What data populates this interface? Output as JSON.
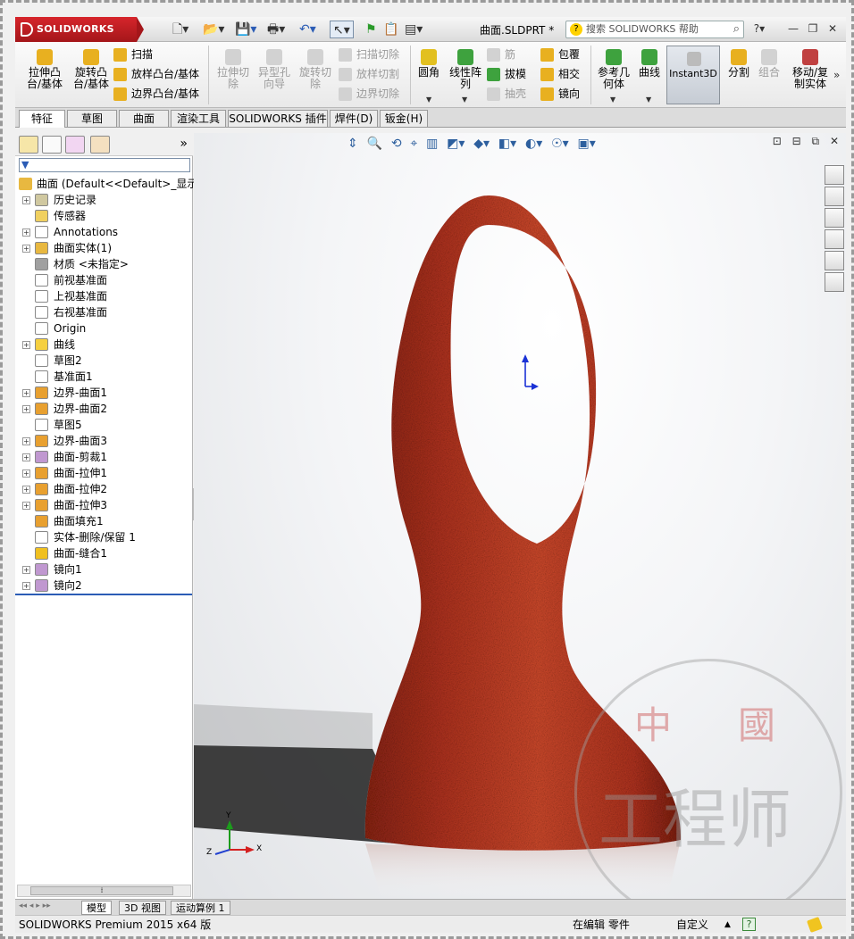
{
  "app": {
    "logo_text": "SOLIDWORKS",
    "document_title": "曲面.SLDPRT *",
    "help_search_placeholder": "搜索 SOLIDWORKS 帮助"
  },
  "ribbon": {
    "extrude_boss": "拉伸凸\n台/基体",
    "revolve_boss": "旋转凸\n台/基体",
    "sweep": "扫描",
    "loft_boss": "放样凸台/基体",
    "boundary_boss": "边界凸台/基体",
    "extrude_cut": "拉伸切\n除",
    "hole_wizard": "异型孔\n向导",
    "revolve_cut": "旋转切\n除",
    "sweep_cut": "扫描切除",
    "loft_cut": "放样切割",
    "boundary_cut": "边界切除",
    "fillet": "圆角",
    "linear_pattern": "线性阵\n列",
    "rib": "筋",
    "draft": "拔模",
    "shell": "抽壳",
    "wrap": "包覆",
    "intersect": "相交",
    "mirror": "镜向",
    "reference_geometry": "参考几\n何体",
    "curves": "曲线",
    "instant3d": "Instant3D",
    "split": "分割",
    "combine": "组合",
    "move_copy": "移动/复\n制实体"
  },
  "tabs": [
    "特征",
    "草图",
    "曲面",
    "渲染工具",
    "SOLIDWORKS 插件",
    "焊件(D)",
    "钣金(H)"
  ],
  "feature_tree": {
    "root": "曲面  (Default<<Default>_显示",
    "items": [
      {
        "label": "历史记录",
        "expandable": true
      },
      {
        "label": "传感器",
        "expandable": false
      },
      {
        "label": "Annotations",
        "expandable": true
      },
      {
        "label": "曲面实体(1)",
        "expandable": true
      },
      {
        "label": "材质 <未指定>",
        "expandable": false
      },
      {
        "label": "前视基准面",
        "expandable": false
      },
      {
        "label": "上视基准面",
        "expandable": false
      },
      {
        "label": "右视基准面",
        "expandable": false
      },
      {
        "label": "Origin",
        "expandable": false
      },
      {
        "label": "曲线",
        "expandable": true
      },
      {
        "label": "草图2",
        "expandable": false
      },
      {
        "label": "基准面1",
        "expandable": false
      },
      {
        "label": "边界-曲面1",
        "expandable": true
      },
      {
        "label": "边界-曲面2",
        "expandable": true
      },
      {
        "label": "草图5",
        "expandable": false
      },
      {
        "label": "边界-曲面3",
        "expandable": true
      },
      {
        "label": "曲面-剪裁1",
        "expandable": true
      },
      {
        "label": "曲面-拉伸1",
        "expandable": true
      },
      {
        "label": "曲面-拉伸2",
        "expandable": true
      },
      {
        "label": "曲面-拉伸3",
        "expandable": true
      },
      {
        "label": "曲面填充1",
        "expandable": false
      },
      {
        "label": "实体-删除/保留 1",
        "expandable": false
      },
      {
        "label": "曲面-缝合1",
        "expandable": false
      },
      {
        "label": "镜向1",
        "expandable": true
      },
      {
        "label": "镜向2",
        "expandable": true
      }
    ]
  },
  "triad": {
    "x": "X",
    "y": "Y",
    "z": "Z"
  },
  "watermark": {
    "top_left": "中",
    "top_right": "國",
    "bottom": "工程师"
  },
  "bottom_tabs": [
    "模型",
    "3D 视图",
    "运动算例 1"
  ],
  "status": {
    "product": "SOLIDWORKS Premium 2015 x64 版",
    "mode": "在编辑 零件",
    "units": "自定义",
    "help_glyph": "?"
  },
  "colors": {
    "model": "#c23f24",
    "accent": "#2b5cb5",
    "brand": "#c81e23"
  }
}
